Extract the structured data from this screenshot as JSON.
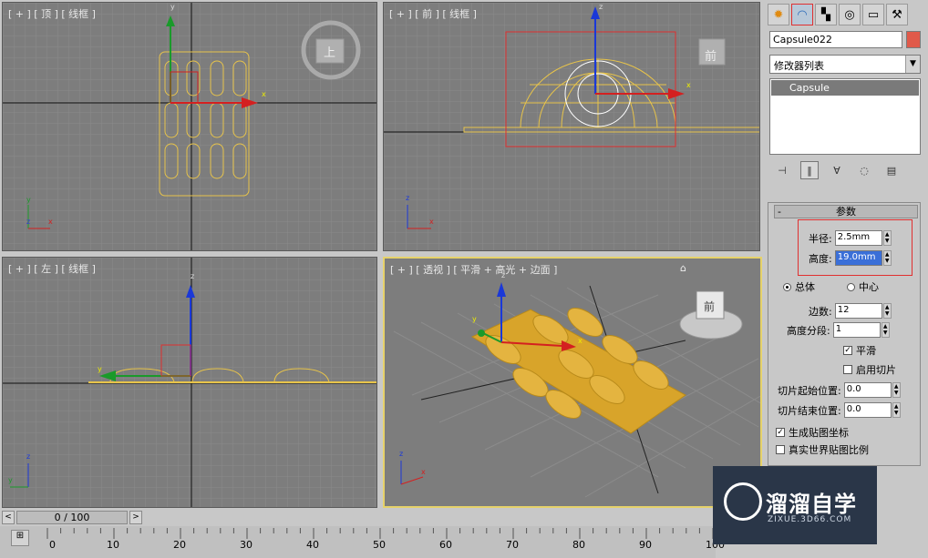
{
  "viewports": {
    "top": {
      "label": "[ + ] [ 顶 ] [ 线框 ]",
      "cube_face": "上",
      "axis": {
        "x": "x",
        "y": "y",
        "z": "z"
      }
    },
    "front": {
      "label": "[ + ] [ 前 ] [ 线框 ]",
      "cube_face": "前",
      "axis": {
        "x": "x",
        "z": "z"
      }
    },
    "left": {
      "label": "[ + ] [ 左 ] [ 线框 ]",
      "axis": {
        "y": "y",
        "z": "z"
      }
    },
    "perspective": {
      "label": "[ + ] [ 透视 ] [ 平滑 + 高光 + 边面 ]",
      "cube_face": "前",
      "axis": {
        "x": "x",
        "y": "y",
        "z": "z"
      }
    }
  },
  "command_panel": {
    "tabs": [
      "create-icon",
      "modify-icon",
      "hierarchy-icon",
      "motion-icon",
      "display-icon",
      "utilities-icon"
    ],
    "object_name": "Capsule022",
    "object_color": "#e05a4a",
    "modifier_list": "修改器列表",
    "stack_items": [
      "Capsule"
    ],
    "rollout_title": "参数",
    "minus": "-",
    "radius_label": "半径:",
    "radius_value": "2.5mm",
    "height_label": "高度:",
    "height_value": "19.0mm",
    "overall_label": "总体",
    "center_label": "中心",
    "sides_label": "边数:",
    "sides_value": "12",
    "height_segs_label": "高度分段:",
    "height_segs_value": "1",
    "smooth_label": "平滑",
    "slice_on_label": "启用切片",
    "slice_from_label": "切片起始位置:",
    "slice_from_value": "0.0",
    "slice_to_label": "切片结束位置:",
    "slice_to_value": "0.0",
    "gen_map_label": "生成贴图坐标",
    "real_world_label": "真实世界贴图比例"
  },
  "timeline": {
    "prev": "<",
    "next": ">",
    "frame": "0 / 100",
    "ticks": [
      "0",
      "10",
      "20",
      "30",
      "40",
      "50",
      "60",
      "70",
      "80",
      "90",
      "100"
    ]
  },
  "watermark": {
    "title": "溜溜自学",
    "url": "ZIXUE.3D66.COM"
  }
}
